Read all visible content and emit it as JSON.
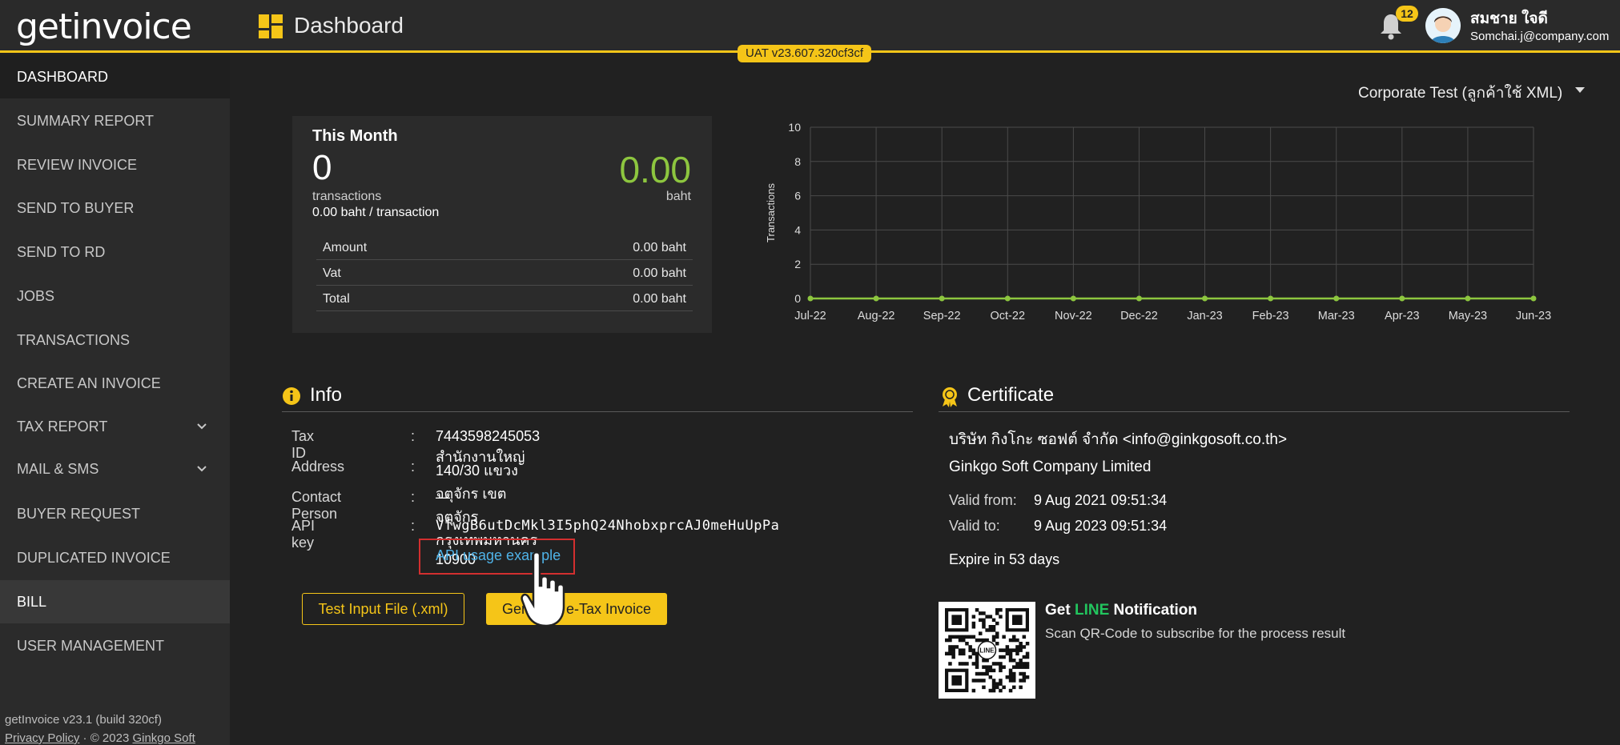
{
  "header": {
    "logo": "getinvoice",
    "title": "Dashboard",
    "version": "UAT v23.607.320cf3cf",
    "notifications": "12",
    "user_name": "สมชาย ใจดี",
    "user_email": "Somchai.j@company.com"
  },
  "sidebar": {
    "items": [
      {
        "label": "DASHBOARD"
      },
      {
        "label": "SUMMARY REPORT"
      },
      {
        "label": "REVIEW INVOICE"
      },
      {
        "label": "SEND TO BUYER"
      },
      {
        "label": "SEND TO RD"
      },
      {
        "label": "JOBS"
      },
      {
        "label": "TRANSACTIONS"
      },
      {
        "label": "CREATE AN INVOICE"
      },
      {
        "label": "TAX REPORT"
      },
      {
        "label": "MAIL & SMS"
      },
      {
        "label": "BUYER REQUEST"
      },
      {
        "label": "DUPLICATED INVOICE"
      },
      {
        "label": "BILL"
      },
      {
        "label": "USER MANAGEMENT"
      }
    ],
    "footer_build": "getInvoice v23.1 (build 320cf)",
    "privacy": "Privacy Policy",
    "separator": "·",
    "copyright": "© 2023",
    "company_link": "Ginkgo Soft"
  },
  "company_selector": "Corporate Test (ลูกค้าใช้ XML)",
  "this_month": {
    "title": "This Month",
    "count": "0",
    "count_label": "transactions",
    "per_txn": "0.00 baht / transaction",
    "amount": "0.00",
    "amount_unit": "baht",
    "rows": [
      {
        "label": "Amount",
        "value": "0.00 baht"
      },
      {
        "label": "Vat",
        "value": "0.00 baht"
      },
      {
        "label": "Total",
        "value": "0.00 baht"
      }
    ]
  },
  "chart_data": {
    "type": "line",
    "categories": [
      "Jul-22",
      "Aug-22",
      "Sep-22",
      "Oct-22",
      "Nov-22",
      "Dec-22",
      "Jan-23",
      "Feb-23",
      "Mar-23",
      "Apr-23",
      "May-23",
      "Jun-23"
    ],
    "series": [
      {
        "values": [
          0,
          0,
          0,
          0,
          0,
          0,
          0,
          0,
          0,
          0,
          0,
          0
        ]
      }
    ],
    "ylabel": "Transactions",
    "yticks": [
      "0",
      "2",
      "4",
      "6",
      "8",
      "10"
    ],
    "ylim": [
      0,
      10
    ],
    "grid": true,
    "line_color": "#8dc63f"
  },
  "info": {
    "title": "Info",
    "tax_id_label": "Tax ID",
    "tax_id": "7443598245053 สำนักงานใหญ่",
    "address_label": "Address",
    "address": "140/30 แขวงจตุจักร เขตจตุจักร กรุงเทพมหานคร 10900",
    "contact_label": "Contact Person",
    "contact": "—",
    "api_key_label": "API key",
    "api_key": "VfwgB6utDcMkl3I5phQ24NhobxprcAJ0meHuUpPa",
    "colon": ":",
    "api_example": "API usage example",
    "btn_test": "Test Input File (.xml)",
    "btn_generate": "Generate e-Tax Invoice"
  },
  "certificate": {
    "title": "Certificate",
    "owner": "บริษัท กิงโกะ ซอฟต์ จำกัด <info@ginkgosoft.co.th>",
    "company_en": "Ginkgo Soft Company Limited",
    "valid_from_label": "Valid from:",
    "valid_from": "9 Aug 2021 09:51:34",
    "valid_to_label": "Valid to:",
    "valid_to": "9 Aug 2023 09:51:34",
    "expire": "Expire in 53 days",
    "line_get": "Get",
    "line_word": "LINE",
    "line_notif": "Notification",
    "line_desc": "Scan QR-Code to subscribe for the process result",
    "qr_logo_text": "LINE"
  },
  "colors": {
    "accent": "#f5c518",
    "positive": "#8dc63f",
    "link": "#4fb3e8",
    "highlight_box": "#d32f2f"
  }
}
